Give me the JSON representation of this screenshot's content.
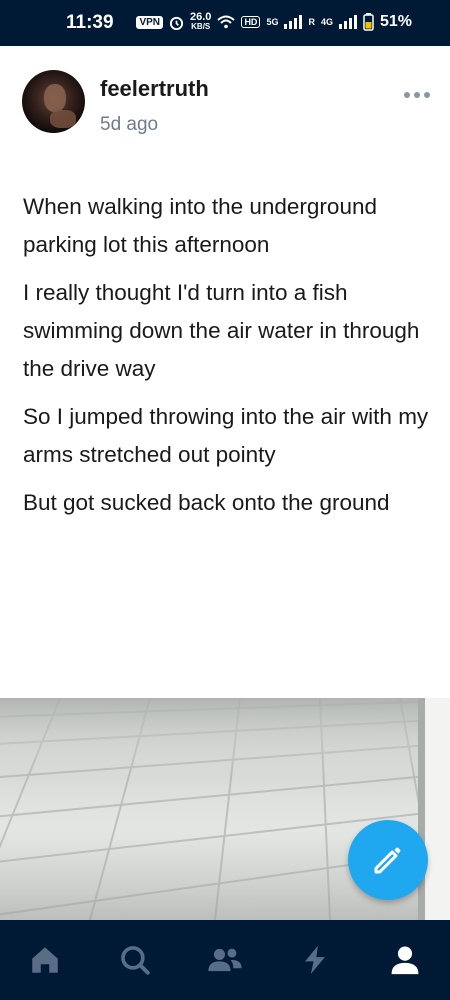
{
  "status_bar": {
    "time": "11:39",
    "vpn": "VPN",
    "speed_value": "26.0",
    "speed_unit": "KB/S",
    "hd": "HD",
    "sim1": "5G",
    "sim2": "4G",
    "sim2_roaming": "R",
    "battery": "51%"
  },
  "post": {
    "username": "feelertruth",
    "age": "5d ago",
    "paragraphs": [
      "When walking into the underground parking lot this afternoon",
      "I really thought I'd turn into a fish swimming down the air water in through the drive way",
      "So I jumped throwing into the air with my arms stretched out pointy",
      "But got sucked back onto the ground"
    ]
  },
  "nav": {
    "items": [
      "home-icon",
      "search-icon",
      "people-icon",
      "activity-icon",
      "account-icon"
    ],
    "active": "account-icon",
    "inactive_color": "#5a6d86",
    "active_color": "#ffffff"
  },
  "colors": {
    "nav_background": "#001935",
    "fab": "#1fa8f0"
  }
}
